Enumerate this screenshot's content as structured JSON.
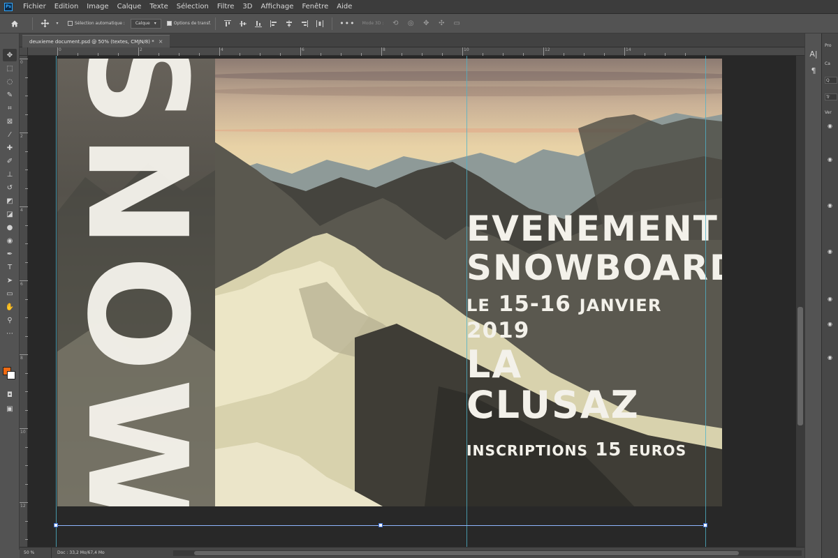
{
  "menubar": {
    "app_icon": "Ps",
    "items": [
      "Fichier",
      "Edition",
      "Image",
      "Calque",
      "Texte",
      "Sélection",
      "Filtre",
      "3D",
      "Affichage",
      "Fenêtre",
      "Aide"
    ]
  },
  "options": {
    "auto_select_label": "Sélection automatique :",
    "layer_select_value": "Calque",
    "transform_label": "Options de transf.",
    "mode_3d_label": "Mode 3D :"
  },
  "document": {
    "tab_title": "deuxieme document.psd @ 50% (textes, CMJN/8) *",
    "close_symbol": "×"
  },
  "poster": {
    "vertical_title": "SNOW",
    "line1": "EVENEMENT",
    "line2": "SNOWBOARD",
    "line3_prefix": "LE",
    "line3_dates": "15-16",
    "line3_month": "JANVIER",
    "line3_year": "2019",
    "line4": "LA CLUSAZ",
    "line5_label": "INSCRIPTIONS",
    "line5_price": "15",
    "line5_currency": "EUROS"
  },
  "status": {
    "zoom": "50 %",
    "doc_info": "Doc : 33,2 Mo/67,4 Mo"
  },
  "colors": {
    "foreground": "#f06a12",
    "background": "#ffffff",
    "guide": "#4fb3c9"
  },
  "rulers": {
    "top_labels": [
      "0",
      "2",
      "4",
      "6",
      "8",
      "10",
      "12",
      "14"
    ],
    "left_labels": [
      "0",
      "2",
      "4",
      "6",
      "8",
      "10",
      "12"
    ]
  },
  "panels": {
    "right_tabs": [
      "Pro",
      "Ca",
      "Q",
      "Tr",
      "Ver"
    ]
  }
}
